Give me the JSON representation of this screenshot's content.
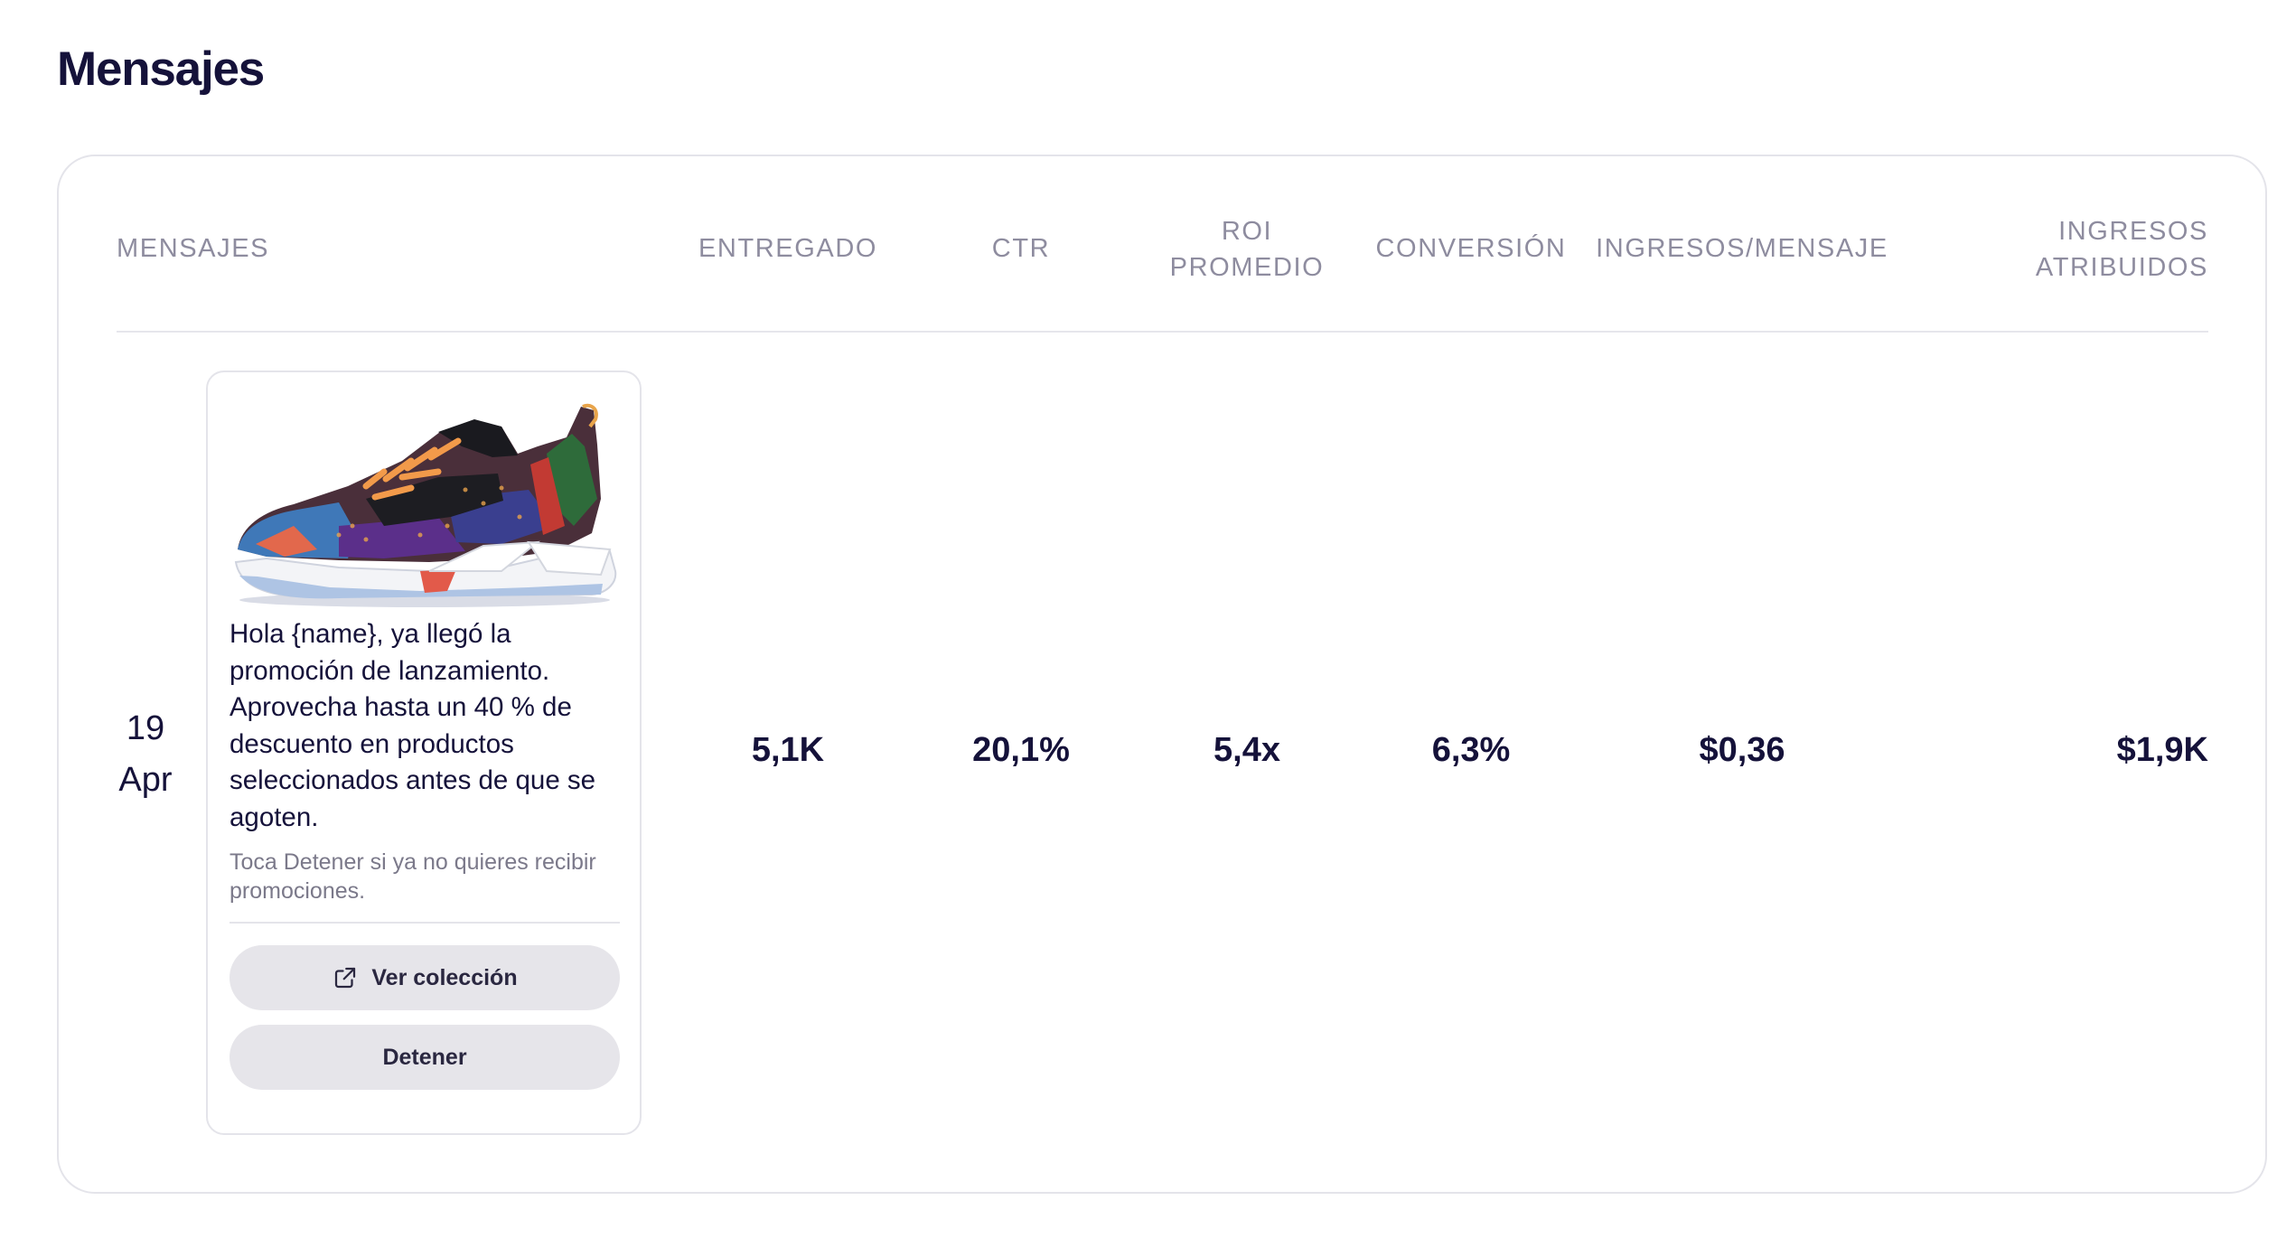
{
  "page": {
    "title": "Mensajes"
  },
  "table": {
    "headers": {
      "mensajes": "MENSAJES",
      "entregado": "ENTREGADO",
      "ctr": "CTR",
      "roi_line1": "ROI",
      "roi_line2": "PROMEDIO",
      "conversion": "CONVERSIÓN",
      "ingresos_mensaje": "INGRESOS/MENSAJE",
      "atribuidos_line1": "INGRESOS",
      "atribuidos_line2": "ATRIBUIDOS"
    },
    "rows": [
      {
        "date_day": "19",
        "date_month": "Apr",
        "message": {
          "image_icon": "sneaker-image",
          "body": "Hola {name}, ya llegó la promoción de lanzamiento. Aprovecha hasta un 40 % de descuento en productos seleccionados antes de que se agoten.",
          "footer": "Toca Detener si ya no quieres recibir promociones.",
          "primary_button": "Ver colección",
          "primary_button_icon": "external-link-icon",
          "secondary_button": "Detener"
        },
        "entregado": "5,1K",
        "ctr": "20,1%",
        "roi": "5,4x",
        "conversion": "6,3%",
        "ingresos_mensaje": "$0,36",
        "ingresos_atribuidos": "$1,9K"
      }
    ]
  },
  "colors": {
    "title": "#15123a",
    "header_text": "#8e8c9f",
    "border": "#e4e4ea",
    "button_bg": "#e6e5ea"
  }
}
